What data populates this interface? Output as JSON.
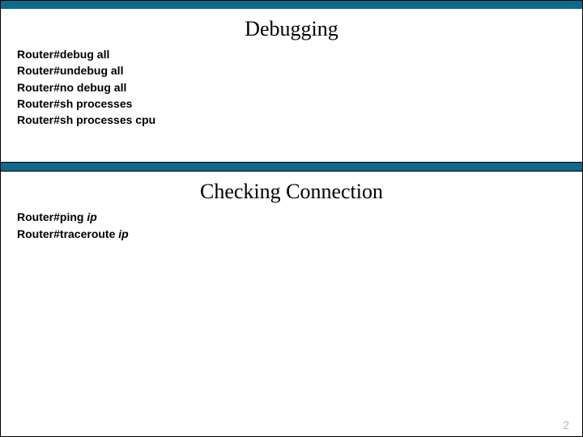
{
  "sections": [
    {
      "title": "Debugging",
      "commands": [
        {
          "prompt": "Router#",
          "cmd": "debug all",
          "arg": ""
        },
        {
          "prompt": "Router#",
          "cmd": "undebug all",
          "arg": ""
        },
        {
          "prompt": "Router#",
          "cmd": "no debug all",
          "arg": ""
        },
        {
          "prompt": "Router#",
          "cmd": "sh processes",
          "arg": ""
        },
        {
          "prompt": "Router#",
          "cmd": "sh processes cpu",
          "arg": ""
        }
      ]
    },
    {
      "title": "Checking Connection",
      "commands": [
        {
          "prompt": "Router#",
          "cmd": "ping ",
          "arg": "ip"
        },
        {
          "prompt": "Router#",
          "cmd": "traceroute ",
          "arg": "ip"
        }
      ]
    }
  ],
  "page_number": "2"
}
